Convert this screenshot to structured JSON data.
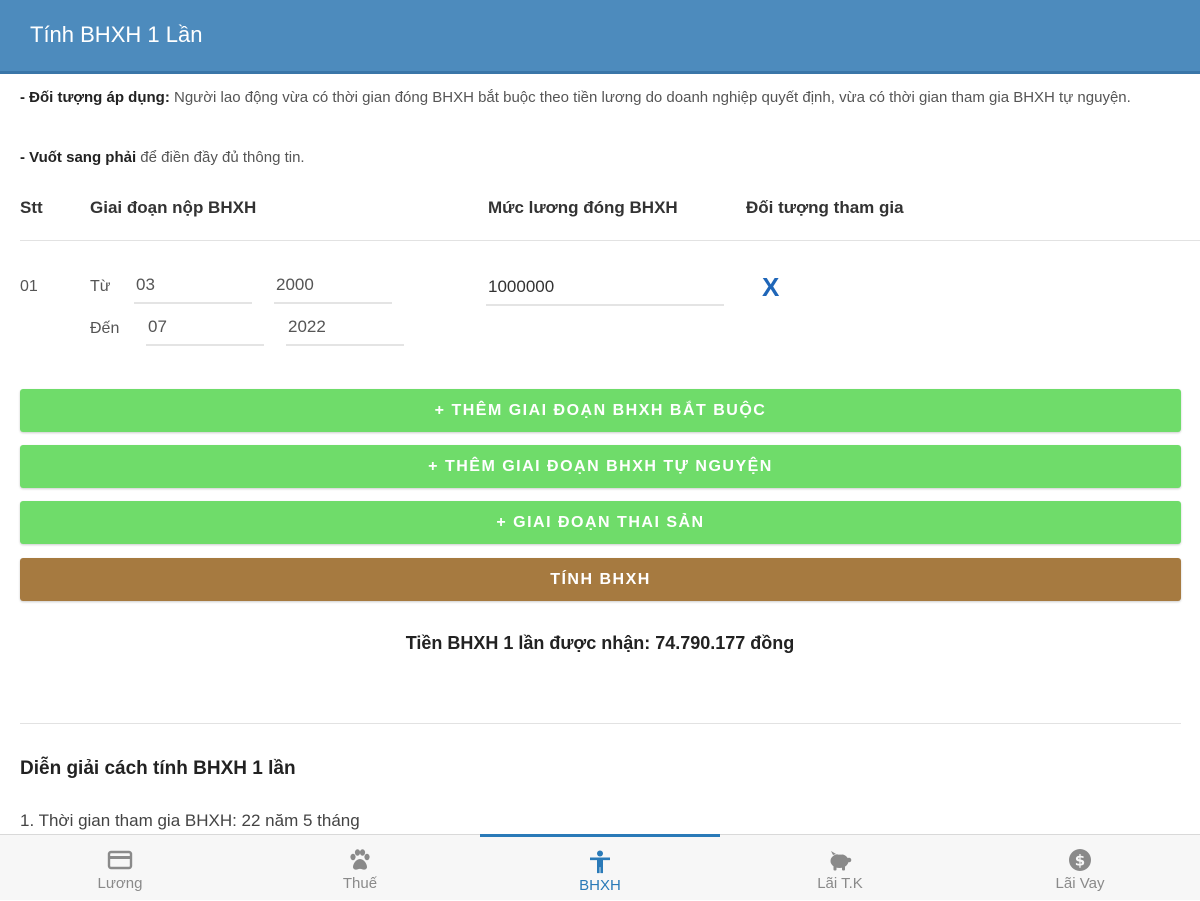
{
  "header": {
    "title": "Tính BHXH 1 Lần"
  },
  "notes": {
    "line1_bold": "- Đối tượng áp dụng:",
    "line1_text": " Người lao động vừa có thời gian đóng BHXH bắt buộc theo tiền lương do doanh nghiệp quyết định, vừa có thời gian tham gia BHXH tự nguyện.",
    "line2_bold": "- Vuốt sang phải",
    "line2_text": " để điền đầy đủ thông tin."
  },
  "table": {
    "headers": [
      "Stt",
      "Giai đoạn nộp BHXH",
      "Mức lương đóng BHXH",
      "Đối tượng tham gia"
    ],
    "row": {
      "stt": "01",
      "from_label": "Từ",
      "from_month": "03",
      "from_year": "2000",
      "to_label": "Đến",
      "to_month": "07",
      "to_year": "2022",
      "salary": "1000000",
      "delete_label": "X"
    }
  },
  "buttons": {
    "add_mandatory": "+ THÊM GIAI ĐOẠN BHXH BẮT BUỘC",
    "add_voluntary": "+ THÊM GIAI ĐOẠN BHXH TỰ NGUYỆN",
    "add_maternity": "+ GIAI ĐOẠN THAI SẢN",
    "calculate": "TÍNH BHXH"
  },
  "result": {
    "text": "Tiền BHXH 1 lần được nhận: 74.790.177 đồng"
  },
  "explanation": {
    "title": "Diễn giải cách tính BHXH 1 lần",
    "line1": "1. Thời gian tham gia BHXH: 22 năm 5 tháng"
  },
  "tabs": [
    {
      "label": "Lương",
      "icon": "card-icon"
    },
    {
      "label": "Thuế",
      "icon": "paw-icon"
    },
    {
      "label": "BHXH",
      "icon": "person-icon",
      "active": true
    },
    {
      "label": "Lãi T.K",
      "icon": "piggy-bank-icon"
    },
    {
      "label": "Lãi Vay",
      "icon": "dollar-icon"
    }
  ],
  "colors": {
    "header": "#4d8bbd",
    "green_button": "#6fdc6a",
    "brown_button": "#a67a40",
    "active_tab": "#2a7ab8",
    "delete_x": "#1f66b8"
  }
}
